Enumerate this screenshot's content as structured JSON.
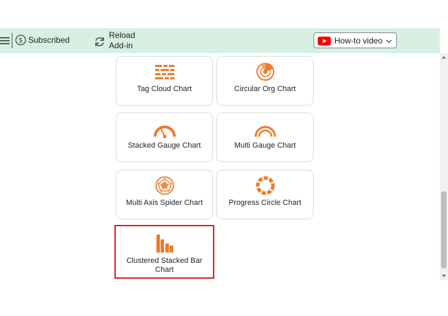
{
  "toolbar": {
    "subscribed_label": "Subscribed",
    "reload_label": "Reload\nAdd-in",
    "howto_label": "How-to video"
  },
  "colors": {
    "accent": "#ee7a2d",
    "topbar": "#d7f0e2",
    "selection": "#d9241d",
    "youtube": "#ff0000"
  },
  "charts": [
    {
      "label": "Tag Cloud Chart",
      "icon": "tag-cloud-icon"
    },
    {
      "label": "Circular Org Chart",
      "icon": "circular-org-icon"
    },
    {
      "label": "Stacked Gauge Chart",
      "icon": "gauge-icon"
    },
    {
      "label": "Multi Gauge Chart",
      "icon": "multi-gauge-icon"
    },
    {
      "label": "Multi Axis Spider Chart",
      "icon": "spider-icon"
    },
    {
      "label": "Progress Circle Chart",
      "icon": "progress-circle-icon"
    },
    {
      "label": "Clustered Stacked Bar Chart",
      "icon": "clustered-bar-icon",
      "selected": true
    }
  ]
}
